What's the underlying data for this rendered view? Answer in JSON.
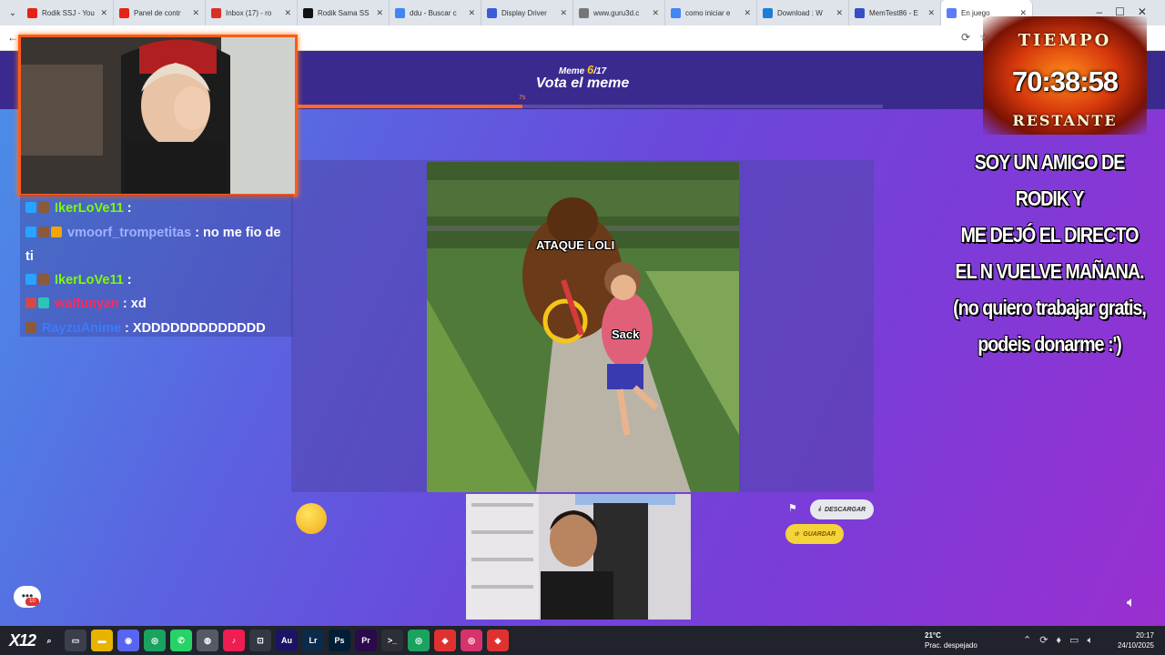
{
  "browser": {
    "tabs": [
      {
        "label": "Rodik SSJ - You",
        "color": "#e62117"
      },
      {
        "label": "Panel de contr",
        "color": "#e62117"
      },
      {
        "label": "Inbox (17) - ro",
        "color": "#d93025"
      },
      {
        "label": "Rodik Sama SS",
        "color": "#111111"
      },
      {
        "label": "ddu - Buscar c",
        "color": "#4285f4"
      },
      {
        "label": "Display Driver",
        "color": "#3b5bdb"
      },
      {
        "label": "www.guru3d.c",
        "color": "#777777"
      },
      {
        "label": "como iniciar e",
        "color": "#4285f4"
      },
      {
        "label": "Download : W",
        "color": "#1c7ed6"
      },
      {
        "label": "MemTest86 - E",
        "color": "#364fc7"
      },
      {
        "label": "En juego",
        "color": "#5c7cfa",
        "active": true
      }
    ]
  },
  "game": {
    "meme_label": "Meme",
    "meme_current": "6",
    "meme_total": "/17",
    "title": "Vota el meme",
    "timer_seconds": "7s",
    "timer_progress": 0.39,
    "caption_top": "ATAQUE LOLI",
    "caption_bottom": "Sack",
    "buttons": {
      "download": "DESCARGAR",
      "save": "GUARDAR"
    }
  },
  "chat": [
    {
      "user": "IkerLoVe11",
      "user_color": "#7cfc00",
      "text": " : ",
      "badges": [
        "#29a3ff",
        "#8a5a3a"
      ]
    },
    {
      "user": "vmoorf_trompetitas",
      "user_color": "#9fb0ff",
      "text": " : no me fio de ti",
      "badges": [
        "#29a3ff",
        "#8a5a3a",
        "#f2a600"
      ]
    },
    {
      "user": "IkerLoVe11",
      "user_color": "#7cfc00",
      "text": " : ",
      "badges": [
        "#29a3ff",
        "#8a5a3a"
      ]
    },
    {
      "user": "waifunyan",
      "user_color": "#ff2a5a",
      "text": " : xd",
      "badges": [
        "#d04a4a",
        "#2ec4b6"
      ]
    },
    {
      "user": "RayzuAnime",
      "user_color": "#3a7bff",
      "text": " : XDDDDDDDDDDDDD",
      "badges": [
        "#8a5a3a"
      ]
    }
  ],
  "overlay": {
    "tiempo": "TIEMPO",
    "time": "70:38:58",
    "restante": "RESTANTE",
    "message_lines": [
      "SOY UN AMIGO DE RODIK Y",
      "ME DEJÓ EL DIRECTO",
      "EL N VUELVE MAÑANA.",
      "(no quiero trabajar gratis,",
      "podeis donarme :')"
    ]
  },
  "notif_count": "10",
  "taskbar": {
    "logo": "X12",
    "icons": [
      {
        "name": "search-icon",
        "glyph": "⌕",
        "color": "#20232b"
      },
      {
        "name": "task-view-icon",
        "glyph": "▭",
        "color": "#3a3f4b"
      },
      {
        "name": "file-explorer-icon",
        "glyph": "▬",
        "color": "#e8b400"
      },
      {
        "name": "discord-icon",
        "glyph": "◉",
        "color": "#5865f2"
      },
      {
        "name": "chrome-icon",
        "glyph": "◎",
        "color": "#1aa260"
      },
      {
        "name": "whatsapp-icon",
        "glyph": "✆",
        "color": "#25d366"
      },
      {
        "name": "app-icon",
        "glyph": "◍",
        "color": "#555b66"
      },
      {
        "name": "tiktok-icon",
        "glyph": "♪",
        "color": "#ee1d52"
      },
      {
        "name": "app-dark-icon",
        "glyph": "⊡",
        "color": "#333842"
      },
      {
        "name": "audition-icon",
        "glyph": "Au",
        "color": "#1b1464"
      },
      {
        "name": "lightroom-icon",
        "glyph": "Lr",
        "color": "#0c2b4b"
      },
      {
        "name": "photoshop-icon",
        "glyph": "Ps",
        "color": "#001e36"
      },
      {
        "name": "premiere-icon",
        "glyph": "Pr",
        "color": "#2a0a4a"
      },
      {
        "name": "terminal-icon",
        "glyph": ">_",
        "color": "#2c2f36"
      },
      {
        "name": "chrome-2-icon",
        "glyph": "◎",
        "color": "#1aa260"
      },
      {
        "name": "anydesk-icon",
        "glyph": "◆",
        "color": "#e03131"
      },
      {
        "name": "chrome-3-icon",
        "glyph": "◎",
        "color": "#d6336c"
      },
      {
        "name": "anydesk-2-icon",
        "glyph": "◆",
        "color": "#e03131"
      }
    ],
    "weather_temp": "21°C",
    "weather_desc": "Prac. despejado",
    "time": "20:17",
    "date": "24/10/2025"
  }
}
